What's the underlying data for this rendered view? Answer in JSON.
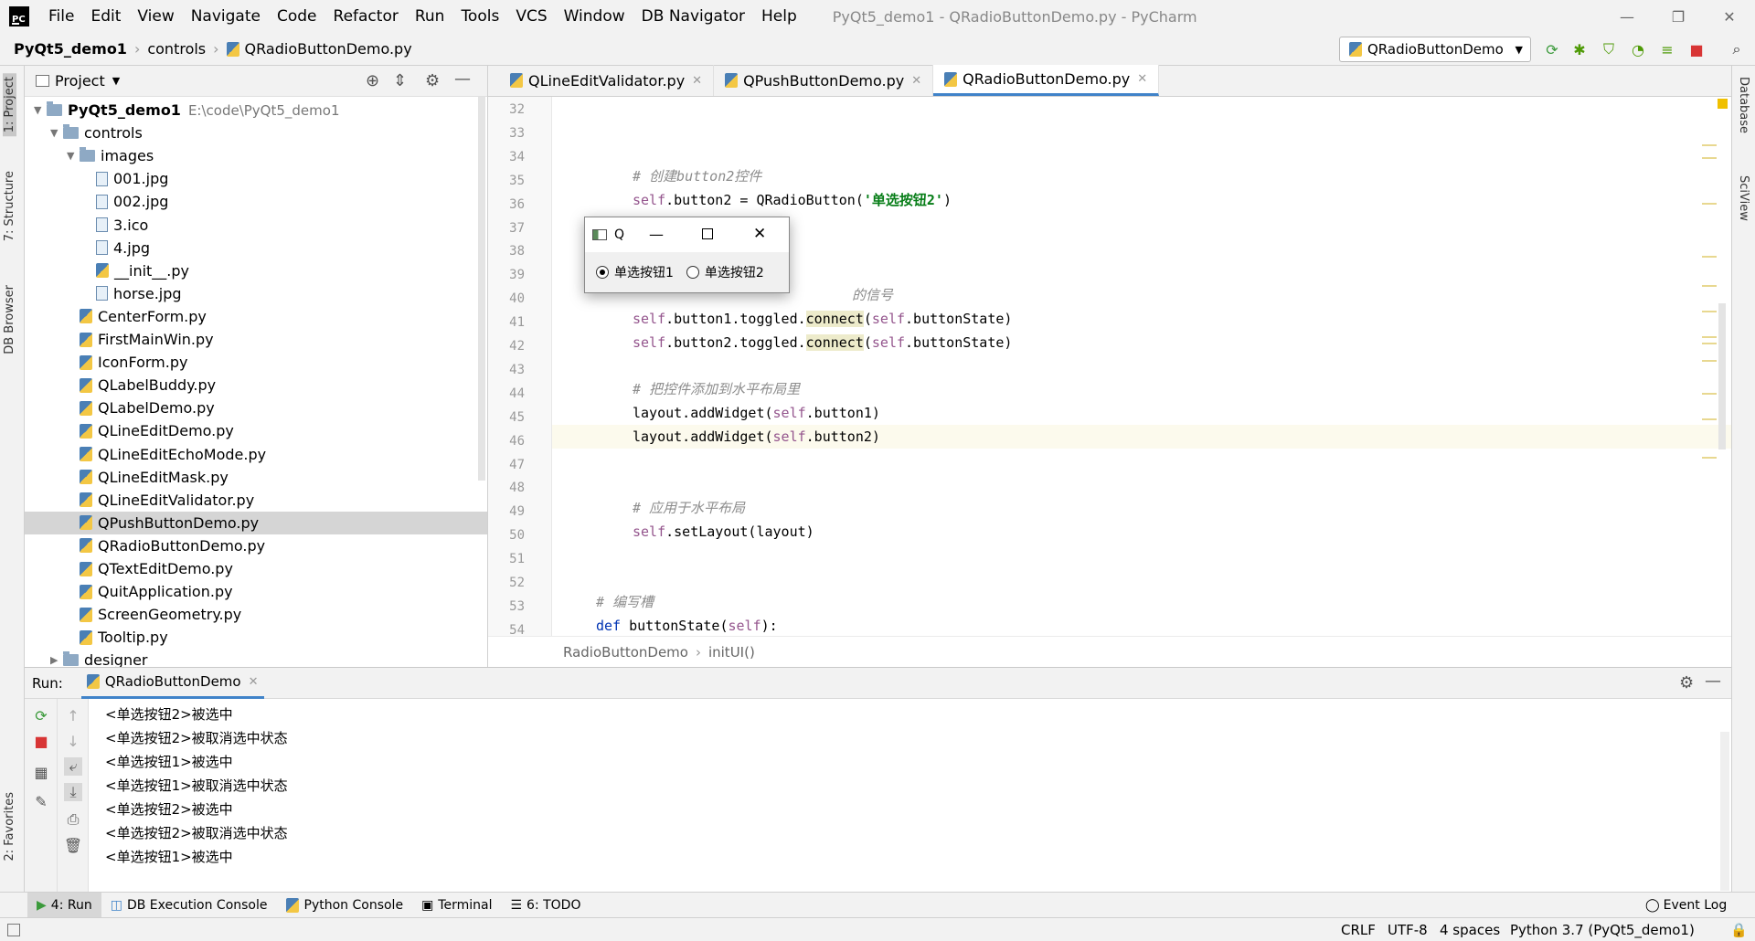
{
  "title_bar": {
    "menus": [
      "File",
      "Edit",
      "View",
      "Navigate",
      "Code",
      "Refactor",
      "Run",
      "Tools",
      "VCS",
      "Window",
      "DB Navigator",
      "Help"
    ],
    "window_title": "PyQt5_demo1 - QRadioButtonDemo.py - PyCharm",
    "minimize": "—",
    "maximize": "❐",
    "close": "✕"
  },
  "nav_bar": {
    "project": "PyQt5_demo1",
    "folder": "controls",
    "file": "QRadioButtonDemo.py",
    "run_config": "QRadioButtonDemo"
  },
  "left_stripe": [
    "1: Project",
    "7: Structure",
    "DB Browser",
    "2: Favorites"
  ],
  "right_stripe": [
    "Database",
    "SciView"
  ],
  "project_panel": {
    "header": "Project",
    "root_name": "PyQt5_demo1",
    "root_path": "E:\\code\\PyQt5_demo1",
    "folder_controls": "controls",
    "folder_images": "images",
    "image_files": [
      "001.jpg",
      "002.jpg",
      "3.ico",
      "4.jpg",
      "__init__.py",
      "horse.jpg"
    ],
    "py_files": [
      "CenterForm.py",
      "FirstMainWin.py",
      "IconForm.py",
      "QLabelBuddy.py",
      "QLabelDemo.py",
      "QLineEditDemo.py",
      "QLineEditEchoMode.py",
      "QLineEditMask.py",
      "QLineEditValidator.py",
      "QPushButtonDemo.py",
      "QRadioButtonDemo.py",
      "QTextEditDemo.py",
      "QuitApplication.py",
      "ScreenGeometry.py",
      "Tooltip.py"
    ],
    "folder_designer": "designer"
  },
  "editor": {
    "tabs": [
      "QLineEditValidator.py",
      "QPushButtonDemo.py",
      "QRadioButtonDemo.py"
    ],
    "line_numbers": [
      "32",
      "33",
      "34",
      "35",
      "36",
      "37",
      "38",
      "39",
      "40",
      "41",
      "42",
      "43",
      "44",
      "45",
      "46",
      "47",
      "48",
      "49",
      "50",
      "51",
      "52",
      "53",
      "54"
    ],
    "code": {
      "c34": "# 创建button2控件",
      "c35a": "self",
      "c35b": ".button2 = QRadioButton(",
      "c35c": "'单选按钮2'",
      "c35d": ")",
      "c39": "的信号",
      "c40a": "self",
      "c40b": ".button1.toggled.",
      "c40c": "connect",
      "c40d": "(",
      "c40e": "self",
      "c40f": ".buttonState)",
      "c41a": "self",
      "c41b": ".button2.toggled.",
      "c41c": "connect",
      "c41d": "(",
      "c41e": "self",
      "c41f": ".buttonState)",
      "c44": "# 把控件添加到水平布局里",
      "c45a": "layout.addWidget(",
      "c45b": "self",
      "c45c": ".button1)",
      "c46a": "layout.addWidget(",
      "c46b": "self",
      "c46c": ".button2)",
      "c49": "# 应用于水平布局",
      "c50a": "self",
      "c50b": ".setLayout(layout)",
      "c53": "# 编写槽",
      "c54a": "def",
      "c54b": " buttonState(",
      "c54c": "self",
      "c54d": "):"
    },
    "breadcrumb_class": "RadioButtonDemo",
    "breadcrumb_method": "initUI()"
  },
  "dialog": {
    "title": "Q",
    "radio1": "单选按钮1",
    "radio2": "单选按钮2",
    "radio1_checked": true
  },
  "run_panel": {
    "label": "Run:",
    "config": "QRadioButtonDemo",
    "output": [
      "<单选按钮2>被选中",
      "<单选按钮2>被取消选中状态",
      "<单选按钮1>被选中",
      "<单选按钮1>被取消选中状态",
      "<单选按钮2>被选中",
      "<单选按钮2>被取消选中状态",
      "<单选按钮1>被选中"
    ]
  },
  "bottom_tabs": {
    "run": "4: Run",
    "db_console": "DB Execution Console",
    "python_console": "Python Console",
    "terminal": "Terminal",
    "todo": "6: TODO",
    "event_log": "Event Log"
  },
  "status_bar": {
    "line_sep": "CRLF",
    "encoding": "UTF-8",
    "indent": "4 spaces",
    "interpreter": "Python 3.7 (PyQt5_demo1)"
  },
  "colors": {
    "accent": "#4083c9",
    "comment": "#8c8c8c",
    "self": "#94558d",
    "string": "#067d17"
  }
}
